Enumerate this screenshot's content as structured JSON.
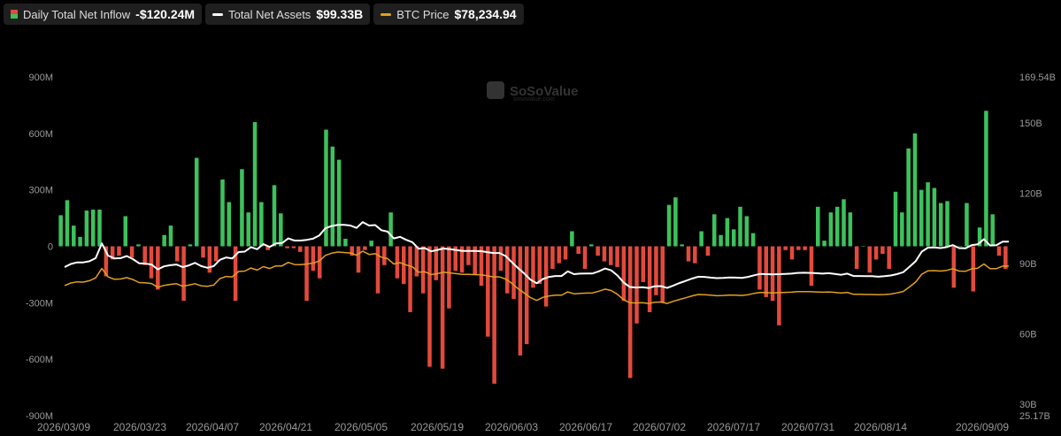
{
  "legend": {
    "inflow": {
      "label": "Daily Total Net Inflow",
      "value": "-$120.24M"
    },
    "assets": {
      "label": "Total Net Assets",
      "value": "$99.33B"
    },
    "btc": {
      "label": "BTC Price",
      "value": "$78,234.94"
    }
  },
  "watermark": {
    "name": "SoSoValue",
    "url": "sosovalue.com"
  },
  "colors": {
    "positive": "#3dc15c",
    "negative": "#e34a3c",
    "assets_line": "#ffffff",
    "btc_line": "#e0a021",
    "background": "#000000"
  },
  "chart_data": {
    "type": "bar+line",
    "x_tick_labels": [
      "2026/03/09",
      "2026/03/23",
      "2026/04/07",
      "2026/04/21",
      "2026/05/05",
      "2026/05/19",
      "2026/06/03",
      "2026/06/17",
      "2026/07/02",
      "2026/07/17",
      "2026/07/31",
      "2026/08/14",
      "2026/09/09"
    ],
    "y_left": {
      "ticks": [
        "900M",
        "600M",
        "300M",
        "0",
        "-300M",
        "-600M",
        "-900M"
      ],
      "range": [
        -900,
        900
      ],
      "unit": "M"
    },
    "y_right": {
      "ticks": [
        "169.54B",
        "150B",
        "120B",
        "90B",
        "60B",
        "30B",
        "25.17B"
      ],
      "range": [
        25.17,
        169.54
      ],
      "unit": "B"
    },
    "grid": false,
    "legend_position": "top-left",
    "series": [
      {
        "name": "Daily Total Net Inflow",
        "type": "bar",
        "axis": "left",
        "values": [
          165,
          245,
          110,
          50,
          190,
          195,
          195,
          -160,
          -70,
          -50,
          160,
          -60,
          10,
          -100,
          -170,
          -230,
          60,
          110,
          -80,
          -290,
          10,
          470,
          -60,
          -140,
          -80,
          355,
          235,
          -290,
          410,
          180,
          660,
          235,
          -20,
          325,
          175,
          -10,
          -10,
          -30,
          -290,
          -130,
          -170,
          620,
          530,
          460,
          40,
          -50,
          -140,
          -20,
          30,
          -250,
          -100,
          180,
          -170,
          -200,
          -350,
          -160,
          -250,
          -640,
          -180,
          -650,
          -330,
          -130,
          -140,
          -100,
          -150,
          -210,
          -480,
          -730,
          -130,
          -250,
          -280,
          -580,
          -520,
          -220,
          -200,
          -320,
          -120,
          -90,
          -70,
          80,
          -40,
          -120,
          10,
          -50,
          -80,
          -100,
          -110,
          -290,
          -700,
          -410,
          -190,
          -350,
          -260,
          -300,
          220,
          260,
          10,
          -80,
          -90,
          80,
          -50,
          170,
          60,
          150,
          90,
          210,
          160,
          70,
          -230,
          -270,
          -290,
          -420,
          -20,
          -70,
          -20,
          -20,
          -210,
          210,
          30,
          180,
          210,
          250,
          180,
          -120,
          0,
          -140,
          -70,
          -40,
          -120,
          290,
          180,
          520,
          600,
          300,
          340,
          310,
          230,
          240,
          -220,
          0,
          230,
          -240,
          100,
          720,
          170,
          -50,
          -120
        ]
      },
      {
        "name": "Total Net Assets",
        "type": "line",
        "axis": "right",
        "values": [
          88.5,
          89.8,
          90.5,
          90.5,
          91.0,
          92.3,
          98.6,
          93.4,
          92.2,
          92.3,
          93.2,
          91.9,
          90.1,
          90.0,
          89.6,
          87.5,
          88.8,
          89.3,
          89.6,
          88.5,
          89.2,
          90.3,
          88.9,
          88.2,
          88.9,
          91.6,
          92.6,
          92.2,
          94.9,
          95.1,
          97.0,
          96.1,
          98.3,
          97.1,
          98.6,
          98.7,
          100.7,
          99.8,
          99.8,
          100.1,
          100.6,
          102.0,
          105.1,
          106.0,
          106.5,
          106.5,
          106.2,
          105.2,
          107.7,
          106.2,
          106.4,
          104.2,
          103.6,
          100.7,
          101.4,
          100.1,
          99.1,
          96.3,
          96.6,
          95.2,
          95.8,
          96.4,
          96.1,
          95.8,
          95.4,
          95.4,
          95.4,
          95.3,
          94.9,
          94.5,
          94.5,
          93.2,
          90.6,
          88.1,
          85.8,
          83.1,
          81.6,
          83.4,
          84.3,
          84.7,
          84.7,
          86.7,
          85.5,
          85.7,
          85.8,
          85.8,
          86.7,
          87.9,
          87.1,
          84.9,
          81.9,
          80.0,
          79.8,
          79.9,
          79.6,
          80.3,
          80.4,
          79.6,
          80.6,
          81.7,
          82.6,
          83.6,
          84.4,
          84.3,
          84.0,
          83.8,
          83.9,
          84.1,
          84.0,
          83.9,
          84.3,
          85.0,
          85.6,
          85.5,
          85.4,
          85.5,
          85.6,
          85.7,
          86.0,
          86.1,
          86.0,
          85.9,
          85.7,
          85.9,
          85.6,
          85.2,
          85.7,
          84.7,
          84.7,
          84.6,
          84.6,
          84.4,
          84.6,
          84.9,
          85.5,
          86.3,
          88.6,
          91.0,
          95.1,
          96.8,
          96.9,
          96.6,
          97.0,
          97.9,
          96.6,
          96.5,
          97.8,
          98.2,
          100.4,
          97.7,
          97.8,
          99.3,
          99.3
        ]
      },
      {
        "name": "BTC Price",
        "type": "line",
        "axis": "right",
        "values": [
          80.6,
          81.7,
          82.2,
          82.1,
          82.7,
          83.9,
          87.9,
          84.3,
          83.3,
          83.4,
          84.0,
          83.2,
          81.9,
          81.8,
          81.5,
          79.9,
          80.7,
          81.1,
          81.4,
          80.3,
          80.8,
          81.4,
          80.5,
          80.3,
          80.8,
          83.6,
          84.5,
          84.3,
          86.6,
          86.8,
          88.1,
          87.2,
          88.7,
          87.9,
          89.0,
          89.0,
          90.5,
          89.6,
          89.5,
          89.8,
          90.2,
          91.1,
          93.5,
          94.4,
          94.9,
          94.7,
          94.5,
          93.6,
          95.3,
          93.9,
          94.2,
          92.7,
          92.1,
          89.8,
          90.4,
          89.4,
          88.6,
          86.3,
          86.5,
          85.3,
          85.7,
          86.3,
          86.0,
          85.7,
          85.4,
          85.4,
          85.3,
          85.2,
          84.8,
          84.3,
          84.3,
          83.4,
          81.6,
          79.3,
          77.4,
          75.5,
          74.3,
          75.6,
          76.2,
          76.5,
          76.5,
          77.9,
          77.1,
          77.3,
          77.4,
          77.5,
          78.2,
          79.1,
          78.5,
          76.9,
          74.6,
          73.3,
          73.2,
          73.3,
          73.0,
          73.5,
          73.6,
          73.0,
          73.9,
          74.7,
          75.4,
          76.2,
          76.8,
          76.7,
          76.5,
          76.3,
          76.4,
          76.6,
          76.5,
          76.4,
          76.7,
          77.3,
          77.7,
          77.6,
          77.5,
          77.6,
          77.7,
          77.8,
          78.0,
          78.0,
          78.0,
          77.9,
          77.8,
          77.9,
          77.7,
          77.4,
          77.7,
          76.9,
          76.9,
          76.8,
          76.8,
          76.7,
          76.8,
          77.0,
          77.5,
          78.1,
          80.0,
          82.1,
          85.5,
          86.9,
          87.0,
          86.8,
          87.1,
          87.8,
          86.8,
          86.7,
          87.7,
          88.0,
          89.8,
          87.8,
          87.8,
          88.9,
          88.9
        ]
      }
    ]
  }
}
